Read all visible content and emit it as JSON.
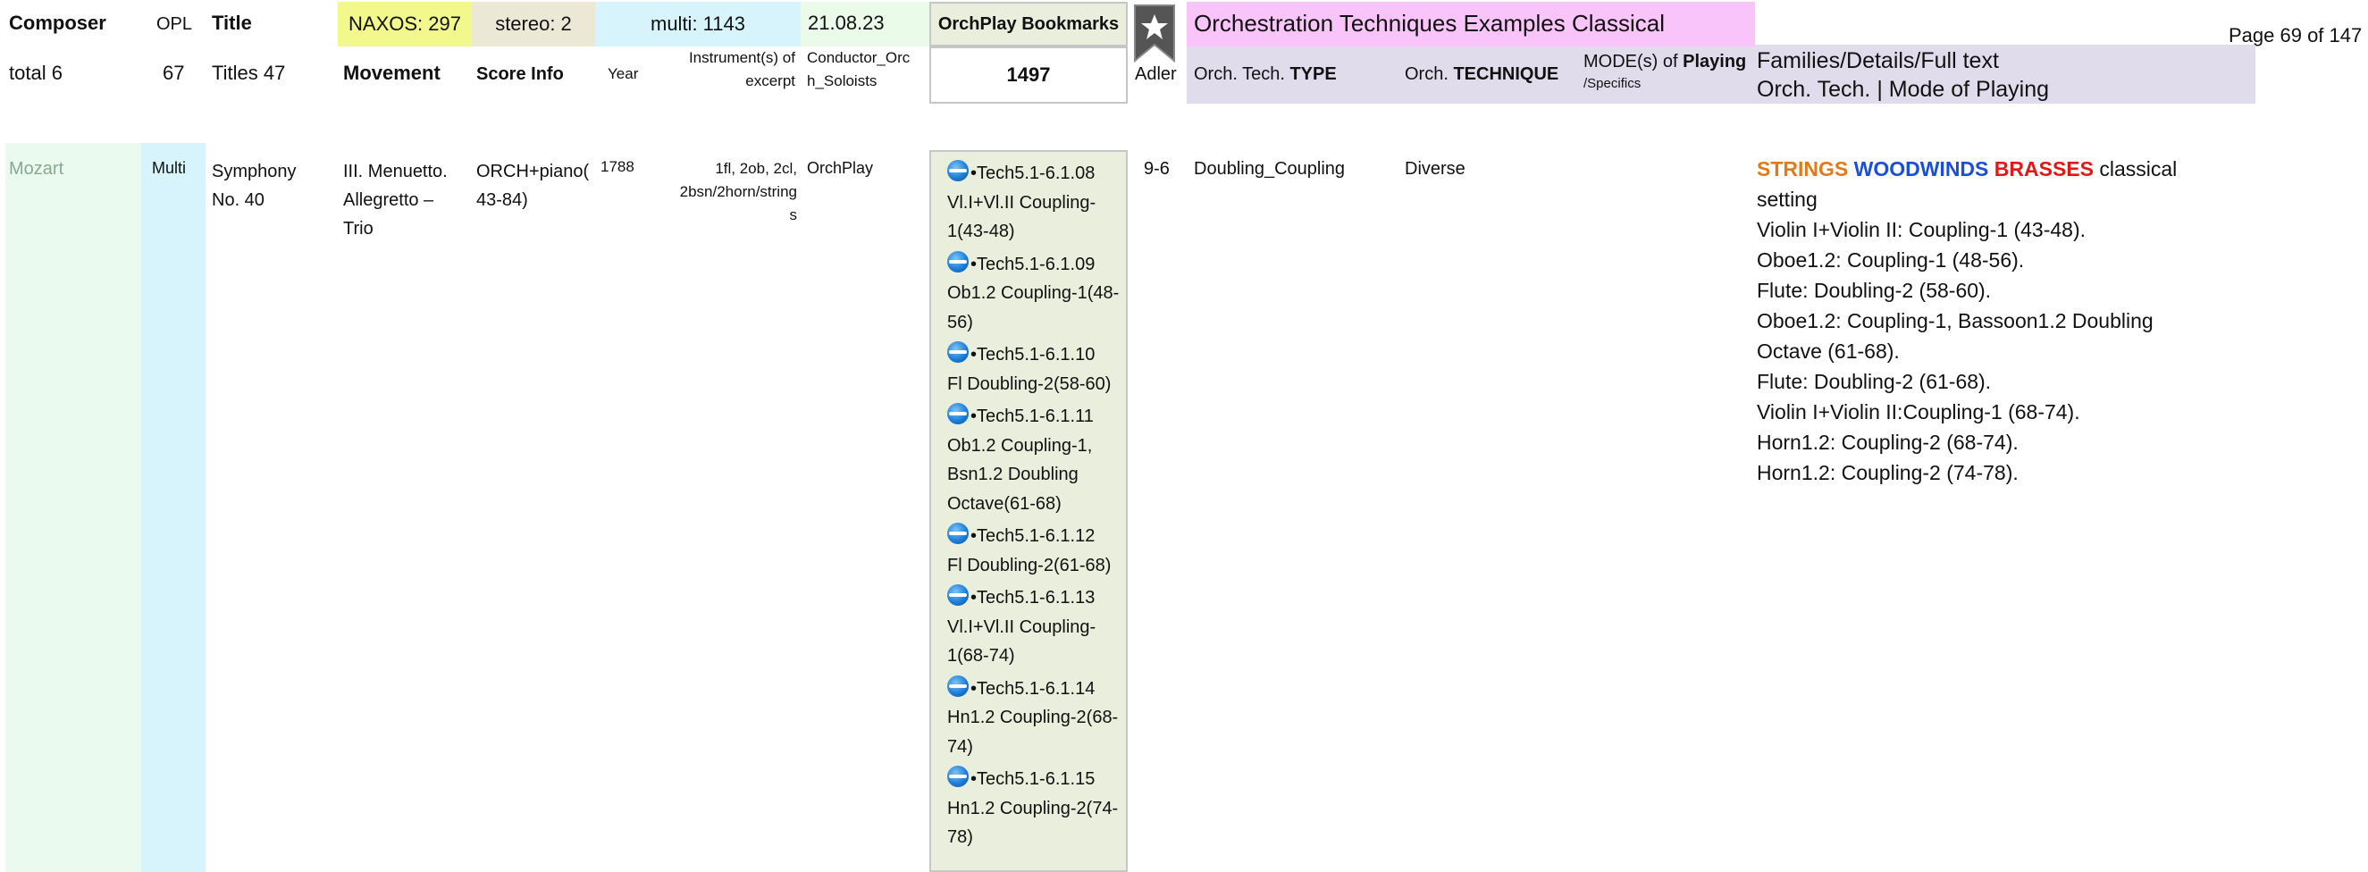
{
  "header": {
    "composer": "Composer",
    "opl": "OPL",
    "title": "Title",
    "naxos": "NAXOS: 297",
    "stereo": "stereo: 2",
    "multi": "multi: 1143",
    "date": "21.08.23",
    "orchplay_bookmarks": "OrchPlay Bookmarks",
    "bookmarks_count": "1497",
    "section_title": "Orchestration Techniques Examples Classical",
    "page": "Page 69 of 147"
  },
  "subheader": {
    "total": "total 6",
    "opl_count": "67",
    "titles": "Titles 47",
    "movement": "Movement",
    "score_info": "Score Info",
    "year": "Year",
    "instruments_line1": "Instrument(s) of",
    "instruments_line2": "excerpt",
    "conductor_line1": "Conductor_Orc",
    "conductor_line2": "h_Soloists",
    "adler": "Adler",
    "type_prefix": "Orch. Tech. ",
    "type_bold": "TYPE",
    "technique_prefix": "Orch. ",
    "technique_bold": "TECHNIQUE",
    "mode_prefix": "MODE(s) of ",
    "mode_bold": "Playing",
    "mode_sub": "/Specifics",
    "families_line1": "Families/Details/Full text",
    "families_line2": "Orch. Tech. | Mode of Playing"
  },
  "row": {
    "composer": "Mozart",
    "opl": "Multi",
    "title_line1": "Symphony",
    "title_line2": "No. 40",
    "movement_line1": "III. Menuetto.",
    "movement_line2": "Allegretto –",
    "movement_line3": "Trio",
    "score_line1": "ORCH+piano(",
    "score_line2": "43-84)",
    "year": "1788",
    "instr_line1": "1fl, 2ob, 2cl,",
    "instr_line2": "2bsn/2horn/string",
    "instr_line3": "s",
    "conductor": "OrchPlay",
    "adler": "9-6",
    "type": "Doubling_Coupling",
    "technique": "Diverse",
    "bookmarks": [
      {
        "code": "•Tech5.1-6.1.08",
        "desc": [
          "Vl.I+Vl.II Coupling-",
          "1(43-48)"
        ]
      },
      {
        "code": "•Tech5.1-6.1.09",
        "desc": [
          "Ob1.2 Coupling-1(48-",
          "56)"
        ]
      },
      {
        "code": "•Tech5.1-6.1.10",
        "desc": [
          "Fl Doubling-2(58-60)"
        ]
      },
      {
        "code": "•Tech5.1-6.1.11",
        "desc": [
          "Ob1.2 Coupling-1,",
          "Bsn1.2 Doubling",
          "Octave(61-68)"
        ]
      },
      {
        "code": "•Tech5.1-6.1.12",
        "desc": [
          "Fl Doubling-2(61-68)"
        ]
      },
      {
        "code": "•Tech5.1-6.1.13",
        "desc": [
          "Vl.I+Vl.II Coupling-",
          "1(68-74)"
        ]
      },
      {
        "code": "•Tech5.1-6.1.14",
        "desc": [
          "Hn1.2 Coupling-2(68-",
          "74)"
        ]
      },
      {
        "code": "•Tech5.1-6.1.15",
        "desc": [
          "Hn1.2 Coupling-2(74-",
          "78)"
        ]
      }
    ],
    "families": {
      "strings": "STRINGS",
      "woodwinds": "WOODWINDS",
      "brasses": "BRASSES",
      "classical": " classical",
      "lines": [
        "setting",
        "Violin I+Violin II: Coupling-1 (43-48).",
        "Oboe1.2: Coupling-1 (48-56).",
        "Flute: Doubling-2 (58-60).",
        "Oboe1.2: Coupling-1, Bassoon1.2 Doubling",
        "Octave (61-68).",
        "Flute: Doubling-2 (61-68).",
        "Violin I+Violin II:Coupling-1 (68-74).",
        "Horn1.2: Coupling-2 (68-74).",
        "Horn1.2: Coupling-2 (74-78)."
      ]
    }
  },
  "icons": {
    "bookmark": "bookmark-star-icon",
    "globe": "globe-icon"
  },
  "colors": {
    "naxos_bg": "#f2f88c",
    "stereo_bg": "#ece8d6",
    "multi_bg": "#d7f3fc",
    "date_bg": "#eafbe9",
    "section_bg": "#f9c4f9",
    "families_bg": "#e0dcec",
    "strings": "#e07b1a",
    "woodwinds": "#1a4fd8",
    "brasses": "#e01818"
  }
}
